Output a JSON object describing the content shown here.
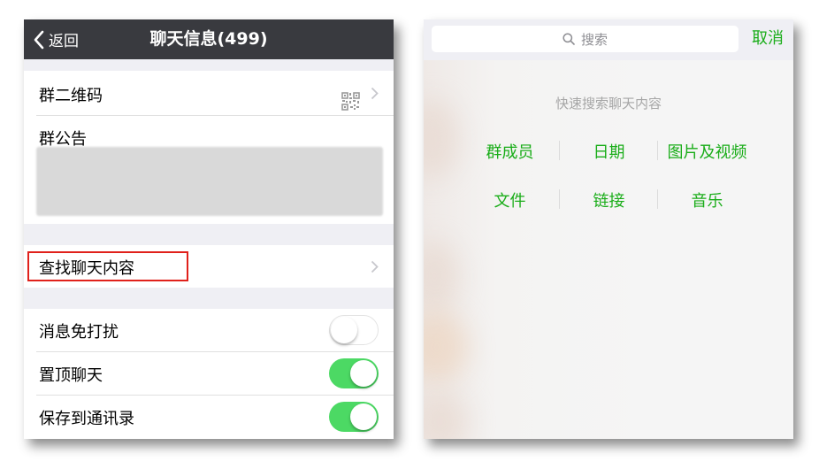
{
  "left_panel": {
    "nav": {
      "back_label": "返回",
      "title": "聊天信息(499)"
    },
    "rows": {
      "qr_code": "群二维码",
      "announcement": "群公告",
      "find_chat_content": "查找聊天内容",
      "mute_notifications": "消息免打扰",
      "sticky_on_top": "置顶聊天",
      "save_to_contacts": "保存到通讯录"
    },
    "toggles": {
      "mute_notifications": false,
      "sticky_on_top": true,
      "save_to_contacts": true
    },
    "highlight_color": "#e0211b",
    "toggle_on_color": "#4cd964"
  },
  "right_panel": {
    "search": {
      "placeholder": "搜索"
    },
    "cancel_label": "取消",
    "hint": "快速搜索聊天内容",
    "categories": [
      "群成员",
      "日期",
      "图片及视频",
      "文件",
      "链接",
      "音乐"
    ],
    "accent_color": "#1aad19"
  }
}
